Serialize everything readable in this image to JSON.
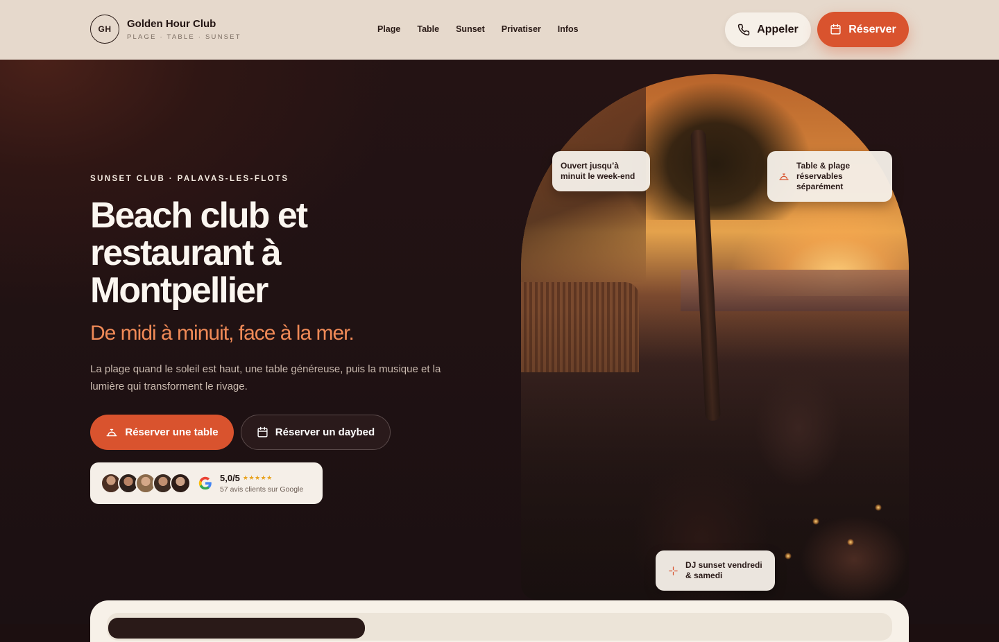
{
  "brand": {
    "initials": "GH",
    "name": "Golden Hour Club",
    "tagline": "PLAGE · TABLE · SUNSET"
  },
  "nav": [
    "Plage",
    "Table",
    "Sunset",
    "Privatiser",
    "Infos"
  ],
  "header_actions": {
    "call_label": "Appeler",
    "book_label": "Réserver"
  },
  "hero": {
    "eyebrow": "SUNSET CLUB · PALAVAS-LES-FLOTS",
    "title": "Beach club et restaurant à Montpellier",
    "subtitle": "De midi à minuit, face à la mer.",
    "lead": "La plage quand le soleil est haut, une table généreuse, puis la musique et la lumière qui transforment le rivage.",
    "cta_table": "Réserver une table",
    "cta_daybed": "Réserver un daybed"
  },
  "reviews": {
    "score": "5,0/5",
    "stars": "★★★★★",
    "subtitle": "57 avis clients sur Google"
  },
  "badges": {
    "open": "Ouvert jusqu’à minuit le week-end",
    "table": "Table & plage réservables séparément",
    "dj": "DJ sunset vendredi & samedi"
  },
  "colors": {
    "accent": "#d9532e",
    "subtitle": "#f08a57",
    "header_bg": "#e6d9cc",
    "hero_bg": "#1c0f10"
  },
  "icons": [
    "phone-icon",
    "calendar-icon",
    "service-bell-icon",
    "sparkle-icon",
    "google-icon"
  ]
}
